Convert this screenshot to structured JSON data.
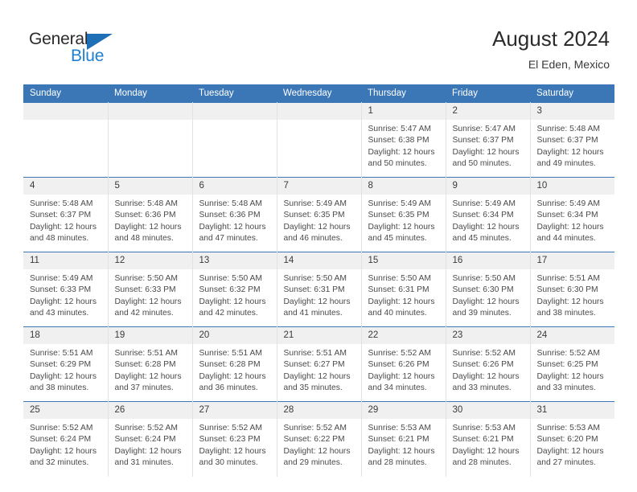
{
  "logo": {
    "word_top": "General",
    "word_bottom": "Blue",
    "triangle_color": "#1f6fb7",
    "blue_text_color": "#1f7fd0"
  },
  "header": {
    "title": "August 2024",
    "subtitle": "El Eden, Mexico",
    "header_bg": "#3b77b6",
    "daynum_bg": "#f0f0f0"
  },
  "weekday_headers": [
    "Sunday",
    "Monday",
    "Tuesday",
    "Wednesday",
    "Thursday",
    "Friday",
    "Saturday"
  ],
  "labels": {
    "sunrise_prefix": "Sunrise: ",
    "sunset_prefix": "Sunset: ",
    "daylight_prefix": "Daylight: "
  },
  "weeks": [
    [
      {
        "day": "",
        "empty": true
      },
      {
        "day": "",
        "empty": true
      },
      {
        "day": "",
        "empty": true
      },
      {
        "day": "",
        "empty": true
      },
      {
        "day": "1",
        "sunrise": "Sunrise: 5:47 AM",
        "sunset": "Sunset: 6:38 PM",
        "daylight1": "Daylight: 12 hours",
        "daylight2": "and 50 minutes."
      },
      {
        "day": "2",
        "sunrise": "Sunrise: 5:47 AM",
        "sunset": "Sunset: 6:37 PM",
        "daylight1": "Daylight: 12 hours",
        "daylight2": "and 50 minutes."
      },
      {
        "day": "3",
        "sunrise": "Sunrise: 5:48 AM",
        "sunset": "Sunset: 6:37 PM",
        "daylight1": "Daylight: 12 hours",
        "daylight2": "and 49 minutes."
      }
    ],
    [
      {
        "day": "4",
        "sunrise": "Sunrise: 5:48 AM",
        "sunset": "Sunset: 6:37 PM",
        "daylight1": "Daylight: 12 hours",
        "daylight2": "and 48 minutes."
      },
      {
        "day": "5",
        "sunrise": "Sunrise: 5:48 AM",
        "sunset": "Sunset: 6:36 PM",
        "daylight1": "Daylight: 12 hours",
        "daylight2": "and 48 minutes."
      },
      {
        "day": "6",
        "sunrise": "Sunrise: 5:48 AM",
        "sunset": "Sunset: 6:36 PM",
        "daylight1": "Daylight: 12 hours",
        "daylight2": "and 47 minutes."
      },
      {
        "day": "7",
        "sunrise": "Sunrise: 5:49 AM",
        "sunset": "Sunset: 6:35 PM",
        "daylight1": "Daylight: 12 hours",
        "daylight2": "and 46 minutes."
      },
      {
        "day": "8",
        "sunrise": "Sunrise: 5:49 AM",
        "sunset": "Sunset: 6:35 PM",
        "daylight1": "Daylight: 12 hours",
        "daylight2": "and 45 minutes."
      },
      {
        "day": "9",
        "sunrise": "Sunrise: 5:49 AM",
        "sunset": "Sunset: 6:34 PM",
        "daylight1": "Daylight: 12 hours",
        "daylight2": "and 45 minutes."
      },
      {
        "day": "10",
        "sunrise": "Sunrise: 5:49 AM",
        "sunset": "Sunset: 6:34 PM",
        "daylight1": "Daylight: 12 hours",
        "daylight2": "and 44 minutes."
      }
    ],
    [
      {
        "day": "11",
        "sunrise": "Sunrise: 5:49 AM",
        "sunset": "Sunset: 6:33 PM",
        "daylight1": "Daylight: 12 hours",
        "daylight2": "and 43 minutes."
      },
      {
        "day": "12",
        "sunrise": "Sunrise: 5:50 AM",
        "sunset": "Sunset: 6:33 PM",
        "daylight1": "Daylight: 12 hours",
        "daylight2": "and 42 minutes."
      },
      {
        "day": "13",
        "sunrise": "Sunrise: 5:50 AM",
        "sunset": "Sunset: 6:32 PM",
        "daylight1": "Daylight: 12 hours",
        "daylight2": "and 42 minutes."
      },
      {
        "day": "14",
        "sunrise": "Sunrise: 5:50 AM",
        "sunset": "Sunset: 6:31 PM",
        "daylight1": "Daylight: 12 hours",
        "daylight2": "and 41 minutes."
      },
      {
        "day": "15",
        "sunrise": "Sunrise: 5:50 AM",
        "sunset": "Sunset: 6:31 PM",
        "daylight1": "Daylight: 12 hours",
        "daylight2": "and 40 minutes."
      },
      {
        "day": "16",
        "sunrise": "Sunrise: 5:50 AM",
        "sunset": "Sunset: 6:30 PM",
        "daylight1": "Daylight: 12 hours",
        "daylight2": "and 39 minutes."
      },
      {
        "day": "17",
        "sunrise": "Sunrise: 5:51 AM",
        "sunset": "Sunset: 6:30 PM",
        "daylight1": "Daylight: 12 hours",
        "daylight2": "and 38 minutes."
      }
    ],
    [
      {
        "day": "18",
        "sunrise": "Sunrise: 5:51 AM",
        "sunset": "Sunset: 6:29 PM",
        "daylight1": "Daylight: 12 hours",
        "daylight2": "and 38 minutes."
      },
      {
        "day": "19",
        "sunrise": "Sunrise: 5:51 AM",
        "sunset": "Sunset: 6:28 PM",
        "daylight1": "Daylight: 12 hours",
        "daylight2": "and 37 minutes."
      },
      {
        "day": "20",
        "sunrise": "Sunrise: 5:51 AM",
        "sunset": "Sunset: 6:28 PM",
        "daylight1": "Daylight: 12 hours",
        "daylight2": "and 36 minutes."
      },
      {
        "day": "21",
        "sunrise": "Sunrise: 5:51 AM",
        "sunset": "Sunset: 6:27 PM",
        "daylight1": "Daylight: 12 hours",
        "daylight2": "and 35 minutes."
      },
      {
        "day": "22",
        "sunrise": "Sunrise: 5:52 AM",
        "sunset": "Sunset: 6:26 PM",
        "daylight1": "Daylight: 12 hours",
        "daylight2": "and 34 minutes."
      },
      {
        "day": "23",
        "sunrise": "Sunrise: 5:52 AM",
        "sunset": "Sunset: 6:26 PM",
        "daylight1": "Daylight: 12 hours",
        "daylight2": "and 33 minutes."
      },
      {
        "day": "24",
        "sunrise": "Sunrise: 5:52 AM",
        "sunset": "Sunset: 6:25 PM",
        "daylight1": "Daylight: 12 hours",
        "daylight2": "and 33 minutes."
      }
    ],
    [
      {
        "day": "25",
        "sunrise": "Sunrise: 5:52 AM",
        "sunset": "Sunset: 6:24 PM",
        "daylight1": "Daylight: 12 hours",
        "daylight2": "and 32 minutes."
      },
      {
        "day": "26",
        "sunrise": "Sunrise: 5:52 AM",
        "sunset": "Sunset: 6:24 PM",
        "daylight1": "Daylight: 12 hours",
        "daylight2": "and 31 minutes."
      },
      {
        "day": "27",
        "sunrise": "Sunrise: 5:52 AM",
        "sunset": "Sunset: 6:23 PM",
        "daylight1": "Daylight: 12 hours",
        "daylight2": "and 30 minutes."
      },
      {
        "day": "28",
        "sunrise": "Sunrise: 5:52 AM",
        "sunset": "Sunset: 6:22 PM",
        "daylight1": "Daylight: 12 hours",
        "daylight2": "and 29 minutes."
      },
      {
        "day": "29",
        "sunrise": "Sunrise: 5:53 AM",
        "sunset": "Sunset: 6:21 PM",
        "daylight1": "Daylight: 12 hours",
        "daylight2": "and 28 minutes."
      },
      {
        "day": "30",
        "sunrise": "Sunrise: 5:53 AM",
        "sunset": "Sunset: 6:21 PM",
        "daylight1": "Daylight: 12 hours",
        "daylight2": "and 28 minutes."
      },
      {
        "day": "31",
        "sunrise": "Sunrise: 5:53 AM",
        "sunset": "Sunset: 6:20 PM",
        "daylight1": "Daylight: 12 hours",
        "daylight2": "and 27 minutes."
      }
    ]
  ]
}
